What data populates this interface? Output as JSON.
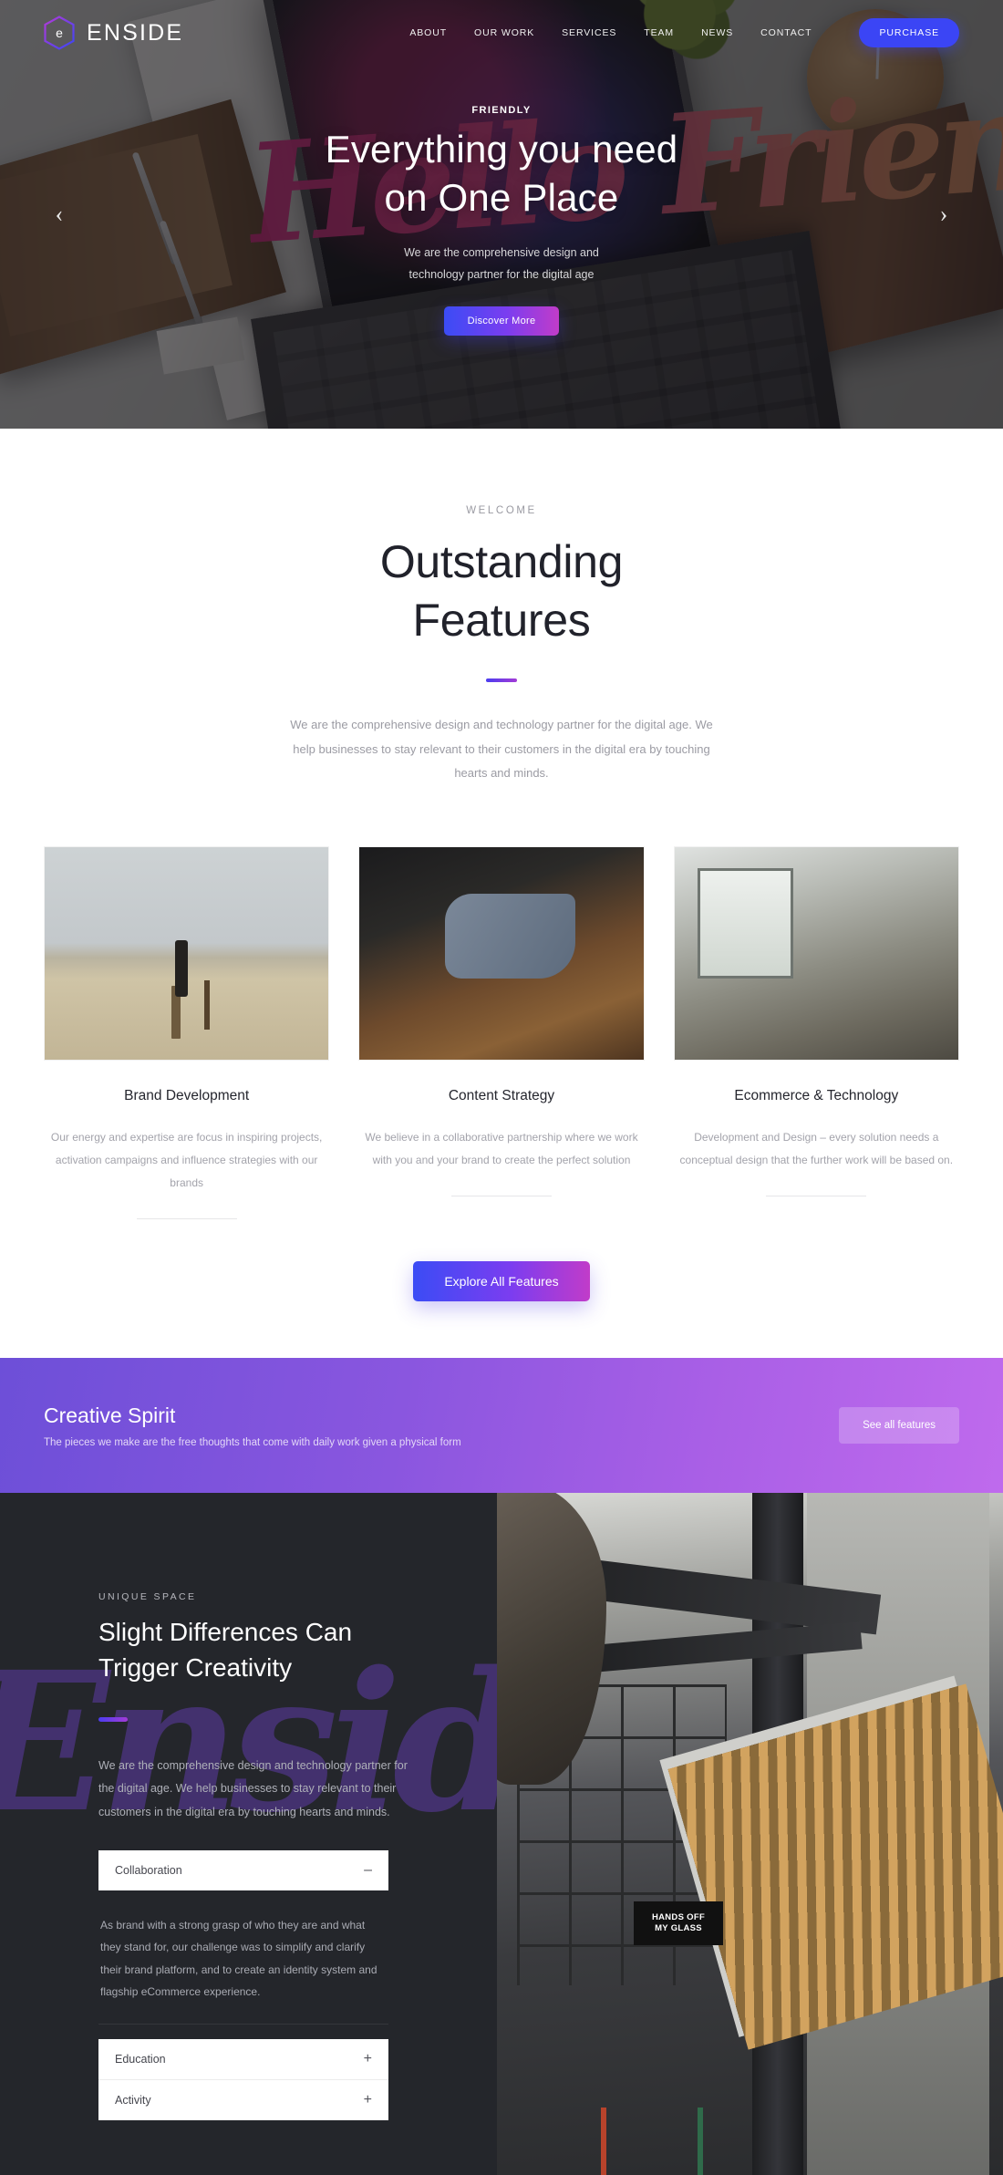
{
  "nav": {
    "brand": "ENSIDE",
    "logo_icon": "hexagon-e-logo",
    "links": [
      "ABOUT",
      "OUR WORK",
      "SERVICES",
      "TEAM",
      "NEWS",
      "CONTACT"
    ],
    "cta": "PURCHASE"
  },
  "hero": {
    "eyebrow": "FRIENDLY",
    "title_line1": "Everything you need",
    "title_line2": "on One Place",
    "subtitle_line1": "We are the comprehensive design and",
    "subtitle_line2": "technology partner for the digital age",
    "button": "Discover More",
    "script_overlay": "Hello Friends",
    "prev_icon": "chevron-left-icon",
    "next_icon": "chevron-right-icon"
  },
  "features": {
    "eyebrow": "WELCOME",
    "title_line1": "Outstanding",
    "title_line2": "Features",
    "description": "We are the comprehensive design and technology partner for the digital age. We help businesses to stay relevant to their customers in the digital era by touching hearts and minds.",
    "cards": [
      {
        "title": "Brand Development",
        "text": "Our energy and expertise are focus in inspiring projects, activation campaigns and influence strategies with our brands",
        "image_alt": "man-with-briefcase-on-hill"
      },
      {
        "title": "Content Strategy",
        "text": "We believe in a collaborative partnership where we work with you and your brand to create the perfect solution",
        "image_alt": "person-writing-at-wooden-table"
      },
      {
        "title": "Ecommerce & Technology",
        "text": "Development and Design – every solution needs a conceptual design that the further work will be based on.",
        "image_alt": "person-in-bright-workshop-interior"
      }
    ],
    "button": "Explore All Features"
  },
  "banner": {
    "title": "Creative Spirit",
    "subtitle": "The pieces we make are the free thoughts that come with daily work given a physical form",
    "button": "See all features"
  },
  "unique": {
    "eyebrow": "UNIQUE SPACE",
    "title_line1": "Slight Differences Can",
    "title_line2": "Trigger Creativity",
    "text": "We are the comprehensive design and technology partner for the digital age. We help businesses to stay relevant to their customers in the digital era by touching hearts and minds.",
    "script_overlay": "Enside",
    "accordion": [
      {
        "label": "Collaboration",
        "sign": "–",
        "open": true,
        "body": "As brand with a strong grasp of who they are and what they stand for,  our challenge was to simplify and clarify their brand platform, and to create an identity system and flagship eCommerce experience."
      },
      {
        "label": "Education",
        "sign": "+",
        "open": false,
        "body": ""
      },
      {
        "label": "Activity",
        "sign": "+",
        "open": false,
        "body": ""
      }
    ],
    "photo_sign_line1": "HANDS OFF",
    "photo_sign_line2": "MY GLASS",
    "image_alt": "industrial-loft-interior-with-tall-windows"
  },
  "colors": {
    "accent_blue": "#3b45f5",
    "accent_purple": "#7b3df0",
    "accent_magenta": "#c13cc9",
    "banner_start": "#6d4fd8",
    "banner_end": "#bf6aed",
    "dark_section": "#24262b"
  }
}
